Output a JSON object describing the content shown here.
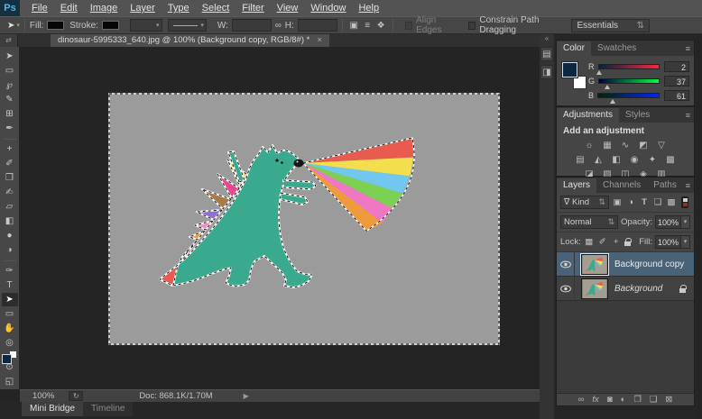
{
  "glyphs": {
    "updown": "⇅",
    "dropdown": "▾",
    "panel_menu": "≡"
  },
  "menu_bar": {
    "logo": "Ps",
    "items": [
      "File",
      "Edit",
      "Image",
      "Layer",
      "Type",
      "Select",
      "Filter",
      "View",
      "Window",
      "Help"
    ]
  },
  "options_bar": {
    "tool_glyph": "➤",
    "fill_label": "Fill:",
    "stroke_label": "Stroke:",
    "w_label": "W:",
    "link_glyph": "∞",
    "h_label": "H:",
    "path_icons": [
      {
        "name": "path-operations-icon",
        "glyph": "▣"
      },
      {
        "name": "path-alignment-icon",
        "glyph": "≡"
      },
      {
        "name": "path-arrangement-icon",
        "glyph": "❖"
      }
    ],
    "align_edges_label": "Align Edges",
    "constrain_label": "Constrain Path Dragging",
    "workspace_label": "Essentials"
  },
  "tab_bar": {
    "scroll_glyph": "⇄",
    "document_title": "dinosaur-5995333_640.jpg @ 100% (Background copy, RGB/8#) *",
    "close_glyph": "×"
  },
  "toolbar": {
    "tools_a": [
      {
        "name": "move-tool",
        "glyph": "➤"
      },
      {
        "name": "marquee-tool",
        "glyph": "▭"
      },
      {
        "name": "lasso-tool",
        "glyph": "℘"
      },
      {
        "name": "quick-selection-tool",
        "glyph": "✎"
      },
      {
        "name": "crop-tool",
        "glyph": "⊞"
      },
      {
        "name": "eyedropper-tool",
        "glyph": "✒"
      }
    ],
    "tools_b": [
      {
        "name": "healing-brush-tool",
        "glyph": "+"
      },
      {
        "name": "brush-tool",
        "glyph": "✐"
      },
      {
        "name": "clone-stamp-tool",
        "glyph": "❒"
      },
      {
        "name": "history-brush-tool",
        "glyph": "✍"
      },
      {
        "name": "eraser-tool",
        "glyph": "▱"
      },
      {
        "name": "gradient-tool",
        "glyph": "◧"
      },
      {
        "name": "blur-tool",
        "glyph": "●"
      },
      {
        "name": "dodge-tool",
        "glyph": "◑"
      }
    ],
    "tools_c": [
      {
        "name": "pen-tool",
        "glyph": "✑"
      },
      {
        "name": "type-tool",
        "glyph": "T"
      },
      {
        "name": "path-selection-tool",
        "glyph": "➤"
      },
      {
        "name": "shape-tool",
        "glyph": "▭"
      },
      {
        "name": "hand-tool",
        "glyph": "✋"
      },
      {
        "name": "zoom-tool",
        "glyph": "◎"
      }
    ],
    "extra": [
      {
        "name": "quick-mask-button",
        "glyph": "⊙"
      },
      {
        "name": "screen-mode-button",
        "glyph": "◱"
      }
    ]
  },
  "dock_strip": {
    "collapse_glyph": "«",
    "icons": [
      {
        "name": "history-panel-icon",
        "glyph": "▤"
      },
      {
        "name": "properties-panel-icon",
        "glyph": "◨"
      }
    ]
  },
  "panels": {
    "color": {
      "tabs": [
        "Color",
        "Swatches"
      ],
      "channels": [
        {
          "label": "R",
          "value": "2"
        },
        {
          "label": "G",
          "value": "37"
        },
        {
          "label": "B",
          "value": "61"
        }
      ]
    },
    "adjustments": {
      "tabs": [
        "Adjustments",
        "Styles"
      ],
      "heading": "Add an adjustment",
      "icons": [
        {
          "name": "brightness-contrast-icon",
          "glyph": "☼"
        },
        {
          "name": "levels-icon",
          "glyph": "▦"
        },
        {
          "name": "curves-icon",
          "glyph": "∿"
        },
        {
          "name": "exposure-icon",
          "glyph": "◩"
        },
        {
          "name": "vibrance-icon",
          "glyph": "▽"
        },
        {
          "name": "hue-saturation-icon",
          "glyph": "▤"
        },
        {
          "name": "color-balance-icon",
          "glyph": "◭"
        },
        {
          "name": "black-white-icon",
          "glyph": "◧"
        },
        {
          "name": "photo-filter-icon",
          "glyph": "◉"
        },
        {
          "name": "channel-mixer-icon",
          "glyph": "✦"
        },
        {
          "name": "color-lookup-icon",
          "glyph": "▩"
        },
        {
          "name": "invert-icon",
          "glyph": "◪"
        },
        {
          "name": "posterize-icon",
          "glyph": "▨"
        },
        {
          "name": "threshold-icon",
          "glyph": "◫"
        },
        {
          "name": "selective-color-icon",
          "glyph": "◈"
        },
        {
          "name": "gradient-map-icon",
          "glyph": "▥"
        }
      ]
    },
    "layers": {
      "tabs": [
        "Layers",
        "Channels",
        "Paths"
      ],
      "filter_icon": "∇",
      "filter_kind": "Kind",
      "filter_icons": [
        {
          "name": "pixel-filter-icon",
          "glyph": "▣"
        },
        {
          "name": "adjustment-filter-icon",
          "glyph": "◑"
        },
        {
          "name": "type-filter-icon",
          "glyph": "T"
        },
        {
          "name": "shape-filter-icon",
          "glyph": "❏"
        },
        {
          "name": "smart-object-filter-icon",
          "glyph": "▩"
        }
      ],
      "blend_mode": "Normal",
      "opacity_label": "Opacity:",
      "opacity_value": "100%",
      "lock_label": "Lock:",
      "lock_icons": [
        {
          "name": "lock-transparency-icon",
          "glyph": "▦"
        },
        {
          "name": "lock-paint-icon",
          "glyph": "✐"
        },
        {
          "name": "lock-position-icon",
          "glyph": "+"
        }
      ],
      "fill_label": "Fill:",
      "fill_value": "100%",
      "items": [
        {
          "name": "Background copy"
        },
        {
          "name": "Background"
        }
      ],
      "bottom_icons": [
        {
          "name": "link-layers-icon",
          "glyph": "∞"
        },
        {
          "name": "layer-style-icon",
          "glyph": "fx"
        },
        {
          "name": "layer-mask-icon",
          "glyph": "◙"
        },
        {
          "name": "new-adjustment-layer-icon",
          "glyph": "◐"
        },
        {
          "name": "new-group-icon",
          "glyph": "❐"
        },
        {
          "name": "new-layer-icon",
          "glyph": "❑"
        },
        {
          "name": "delete-layer-icon",
          "glyph": "⊠"
        }
      ]
    }
  },
  "status_bar": {
    "zoom": "100%",
    "icon_glyph": "↻",
    "doc_info": "Doc: 868.1K/1.70M",
    "flyout_glyph": "▶"
  },
  "bottom_tabs": [
    "Mini Bridge",
    "Timeline"
  ],
  "colors": {
    "menu_bar": "#535353",
    "options_bar": "#464646",
    "panel": "#454545",
    "workspace": "#242424",
    "canvas_image_gray": "#9b9b9b",
    "layer_selection": "#4a6278",
    "foreground_swatch": "#0b2742",
    "dinosaur_teal": "#3aaa8f",
    "rainbow": [
      "#e85c50",
      "#f3df4e",
      "#72c7ee",
      "#7cd153",
      "#f078c2",
      "#f09a3e"
    ]
  }
}
